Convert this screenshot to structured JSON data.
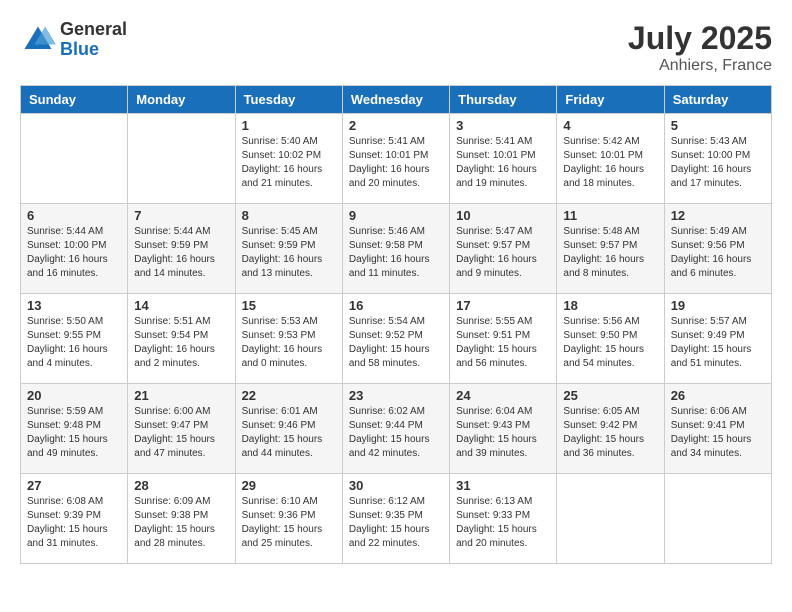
{
  "logo": {
    "general": "General",
    "blue": "Blue"
  },
  "title": "July 2025",
  "location": "Anhiers, France",
  "days_of_week": [
    "Sunday",
    "Monday",
    "Tuesday",
    "Wednesday",
    "Thursday",
    "Friday",
    "Saturday"
  ],
  "weeks": [
    [
      {
        "day": "",
        "sunrise": "",
        "sunset": "",
        "daylight": ""
      },
      {
        "day": "",
        "sunrise": "",
        "sunset": "",
        "daylight": ""
      },
      {
        "day": "1",
        "sunrise": "Sunrise: 5:40 AM",
        "sunset": "Sunset: 10:02 PM",
        "daylight": "Daylight: 16 hours and 21 minutes."
      },
      {
        "day": "2",
        "sunrise": "Sunrise: 5:41 AM",
        "sunset": "Sunset: 10:01 PM",
        "daylight": "Daylight: 16 hours and 20 minutes."
      },
      {
        "day": "3",
        "sunrise": "Sunrise: 5:41 AM",
        "sunset": "Sunset: 10:01 PM",
        "daylight": "Daylight: 16 hours and 19 minutes."
      },
      {
        "day": "4",
        "sunrise": "Sunrise: 5:42 AM",
        "sunset": "Sunset: 10:01 PM",
        "daylight": "Daylight: 16 hours and 18 minutes."
      },
      {
        "day": "5",
        "sunrise": "Sunrise: 5:43 AM",
        "sunset": "Sunset: 10:00 PM",
        "daylight": "Daylight: 16 hours and 17 minutes."
      }
    ],
    [
      {
        "day": "6",
        "sunrise": "Sunrise: 5:44 AM",
        "sunset": "Sunset: 10:00 PM",
        "daylight": "Daylight: 16 hours and 16 minutes."
      },
      {
        "day": "7",
        "sunrise": "Sunrise: 5:44 AM",
        "sunset": "Sunset: 9:59 PM",
        "daylight": "Daylight: 16 hours and 14 minutes."
      },
      {
        "day": "8",
        "sunrise": "Sunrise: 5:45 AM",
        "sunset": "Sunset: 9:59 PM",
        "daylight": "Daylight: 16 hours and 13 minutes."
      },
      {
        "day": "9",
        "sunrise": "Sunrise: 5:46 AM",
        "sunset": "Sunset: 9:58 PM",
        "daylight": "Daylight: 16 hours and 11 minutes."
      },
      {
        "day": "10",
        "sunrise": "Sunrise: 5:47 AM",
        "sunset": "Sunset: 9:57 PM",
        "daylight": "Daylight: 16 hours and 9 minutes."
      },
      {
        "day": "11",
        "sunrise": "Sunrise: 5:48 AM",
        "sunset": "Sunset: 9:57 PM",
        "daylight": "Daylight: 16 hours and 8 minutes."
      },
      {
        "day": "12",
        "sunrise": "Sunrise: 5:49 AM",
        "sunset": "Sunset: 9:56 PM",
        "daylight": "Daylight: 16 hours and 6 minutes."
      }
    ],
    [
      {
        "day": "13",
        "sunrise": "Sunrise: 5:50 AM",
        "sunset": "Sunset: 9:55 PM",
        "daylight": "Daylight: 16 hours and 4 minutes."
      },
      {
        "day": "14",
        "sunrise": "Sunrise: 5:51 AM",
        "sunset": "Sunset: 9:54 PM",
        "daylight": "Daylight: 16 hours and 2 minutes."
      },
      {
        "day": "15",
        "sunrise": "Sunrise: 5:53 AM",
        "sunset": "Sunset: 9:53 PM",
        "daylight": "Daylight: 16 hours and 0 minutes."
      },
      {
        "day": "16",
        "sunrise": "Sunrise: 5:54 AM",
        "sunset": "Sunset: 9:52 PM",
        "daylight": "Daylight: 15 hours and 58 minutes."
      },
      {
        "day": "17",
        "sunrise": "Sunrise: 5:55 AM",
        "sunset": "Sunset: 9:51 PM",
        "daylight": "Daylight: 15 hours and 56 minutes."
      },
      {
        "day": "18",
        "sunrise": "Sunrise: 5:56 AM",
        "sunset": "Sunset: 9:50 PM",
        "daylight": "Daylight: 15 hours and 54 minutes."
      },
      {
        "day": "19",
        "sunrise": "Sunrise: 5:57 AM",
        "sunset": "Sunset: 9:49 PM",
        "daylight": "Daylight: 15 hours and 51 minutes."
      }
    ],
    [
      {
        "day": "20",
        "sunrise": "Sunrise: 5:59 AM",
        "sunset": "Sunset: 9:48 PM",
        "daylight": "Daylight: 15 hours and 49 minutes."
      },
      {
        "day": "21",
        "sunrise": "Sunrise: 6:00 AM",
        "sunset": "Sunset: 9:47 PM",
        "daylight": "Daylight: 15 hours and 47 minutes."
      },
      {
        "day": "22",
        "sunrise": "Sunrise: 6:01 AM",
        "sunset": "Sunset: 9:46 PM",
        "daylight": "Daylight: 15 hours and 44 minutes."
      },
      {
        "day": "23",
        "sunrise": "Sunrise: 6:02 AM",
        "sunset": "Sunset: 9:44 PM",
        "daylight": "Daylight: 15 hours and 42 minutes."
      },
      {
        "day": "24",
        "sunrise": "Sunrise: 6:04 AM",
        "sunset": "Sunset: 9:43 PM",
        "daylight": "Daylight: 15 hours and 39 minutes."
      },
      {
        "day": "25",
        "sunrise": "Sunrise: 6:05 AM",
        "sunset": "Sunset: 9:42 PM",
        "daylight": "Daylight: 15 hours and 36 minutes."
      },
      {
        "day": "26",
        "sunrise": "Sunrise: 6:06 AM",
        "sunset": "Sunset: 9:41 PM",
        "daylight": "Daylight: 15 hours and 34 minutes."
      }
    ],
    [
      {
        "day": "27",
        "sunrise": "Sunrise: 6:08 AM",
        "sunset": "Sunset: 9:39 PM",
        "daylight": "Daylight: 15 hours and 31 minutes."
      },
      {
        "day": "28",
        "sunrise": "Sunrise: 6:09 AM",
        "sunset": "Sunset: 9:38 PM",
        "daylight": "Daylight: 15 hours and 28 minutes."
      },
      {
        "day": "29",
        "sunrise": "Sunrise: 6:10 AM",
        "sunset": "Sunset: 9:36 PM",
        "daylight": "Daylight: 15 hours and 25 minutes."
      },
      {
        "day": "30",
        "sunrise": "Sunrise: 6:12 AM",
        "sunset": "Sunset: 9:35 PM",
        "daylight": "Daylight: 15 hours and 22 minutes."
      },
      {
        "day": "31",
        "sunrise": "Sunrise: 6:13 AM",
        "sunset": "Sunset: 9:33 PM",
        "daylight": "Daylight: 15 hours and 20 minutes."
      },
      {
        "day": "",
        "sunrise": "",
        "sunset": "",
        "daylight": ""
      },
      {
        "day": "",
        "sunrise": "",
        "sunset": "",
        "daylight": ""
      }
    ]
  ]
}
